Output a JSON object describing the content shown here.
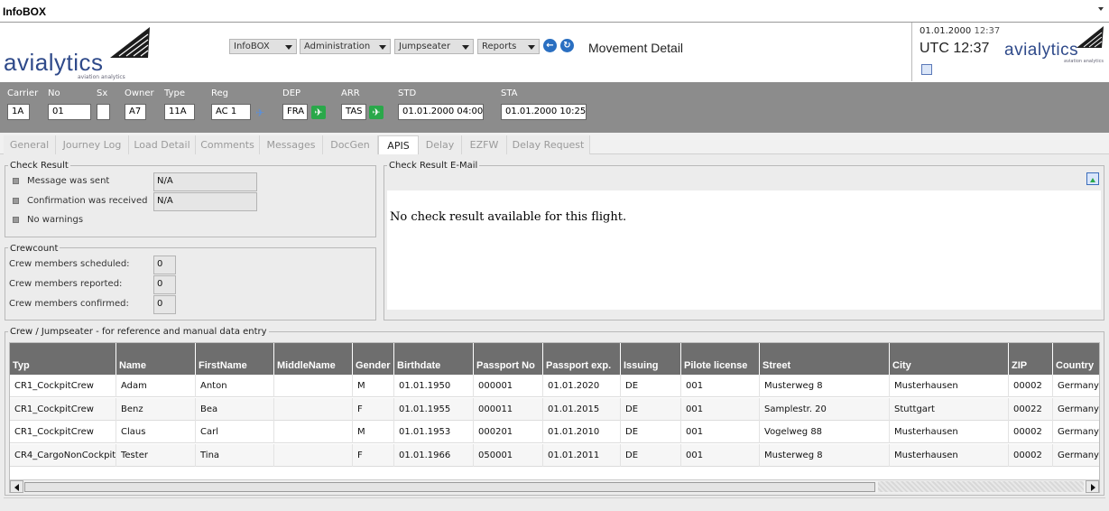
{
  "window": {
    "title": "InfoBOX"
  },
  "brand": {
    "name": "avialytics",
    "tagline": "aviation analytics"
  },
  "menus": [
    {
      "label": "InfoBOX"
    },
    {
      "label": "Administration"
    },
    {
      "label": "Jumpseater"
    },
    {
      "label": "Reports"
    }
  ],
  "page": {
    "title": "Movement Detail"
  },
  "clock": {
    "date": "01.01.2000",
    "time": "12:37",
    "utc_label": "UTC 12:37"
  },
  "movement": {
    "carrier": {
      "label": "Carrier",
      "value": "1A"
    },
    "no": {
      "label": "No",
      "value": "01"
    },
    "sx": {
      "label": "Sx",
      "value": ""
    },
    "owner": {
      "label": "Owner",
      "value": "A7"
    },
    "type": {
      "label": "Type",
      "value": "11A"
    },
    "reg": {
      "label": "Reg",
      "value": "AC 1"
    },
    "dep": {
      "label": "DEP",
      "value": "FRA"
    },
    "arr": {
      "label": "ARR",
      "value": "TAS"
    },
    "std": {
      "label": "STD",
      "value": "01.01.2000 04:00"
    },
    "sta": {
      "label": "STA",
      "value": "01.01.2000 10:25"
    }
  },
  "tabs": [
    {
      "label": "General",
      "active": false
    },
    {
      "label": "Journey Log",
      "active": false
    },
    {
      "label": "Load Detail",
      "active": false
    },
    {
      "label": "Comments",
      "active": false
    },
    {
      "label": "Messages",
      "active": false
    },
    {
      "label": "DocGen",
      "active": false
    },
    {
      "label": "APIS",
      "active": true
    },
    {
      "label": "Delay",
      "active": false
    },
    {
      "label": "EZFW",
      "active": false
    },
    {
      "label": "Delay Request",
      "active": false
    }
  ],
  "check_result": {
    "title": "Check Result",
    "items": [
      {
        "label": "Message was sent",
        "value": "N/A"
      },
      {
        "label": "Confirmation was received",
        "value": "N/A"
      },
      {
        "label": "No warnings",
        "value": ""
      }
    ]
  },
  "crewcount": {
    "title": "Crewcount",
    "items": [
      {
        "label": "Crew members scheduled:",
        "value": "0"
      },
      {
        "label": "Crew members reported:",
        "value": "0"
      },
      {
        "label": "Crew members confirmed:",
        "value": "0"
      }
    ]
  },
  "email": {
    "title": "Check Result E-Mail",
    "message": "No check result available for this flight."
  },
  "crew_table": {
    "title": "Crew / Jumpseater - for reference and manual data entry",
    "columns": [
      "Typ",
      "Name",
      "FirstName",
      "MiddleName",
      "Gender",
      "Birthdate",
      "Passport No",
      "Passport exp.",
      "Issuing",
      "Pilote license",
      "Street",
      "City",
      "ZIP",
      "Country"
    ],
    "rows": [
      [
        "CR1_CockpitCrew",
        "Adam",
        "Anton",
        "",
        "M",
        "01.01.1950",
        "000001",
        "01.01.2020",
        "DE",
        "001",
        "Musterweg 8",
        "Musterhausen",
        "00002",
        "Germany"
      ],
      [
        "CR1_CockpitCrew",
        "Benz",
        "Bea",
        "",
        "F",
        "01.01.1955",
        "000011",
        "01.01.2015",
        "DE",
        "001",
        "Samplestr. 20",
        "Stuttgart",
        "00022",
        "Germany"
      ],
      [
        "CR1_CockpitCrew",
        "Claus",
        "Carl",
        "",
        "M",
        "01.01.1953",
        "000201",
        "01.01.2010",
        "DE",
        "001",
        "Vogelweg 88",
        "Musterhausen",
        "00002",
        "Germany"
      ],
      [
        "CR4_CargoNonCockpit",
        "Tester",
        "Tina",
        "",
        "F",
        "01.01.1966",
        "050001",
        "01.01.2011",
        "DE",
        "001",
        "Musterweg 8",
        "Musterhausen",
        "00002",
        "Germany"
      ]
    ]
  }
}
